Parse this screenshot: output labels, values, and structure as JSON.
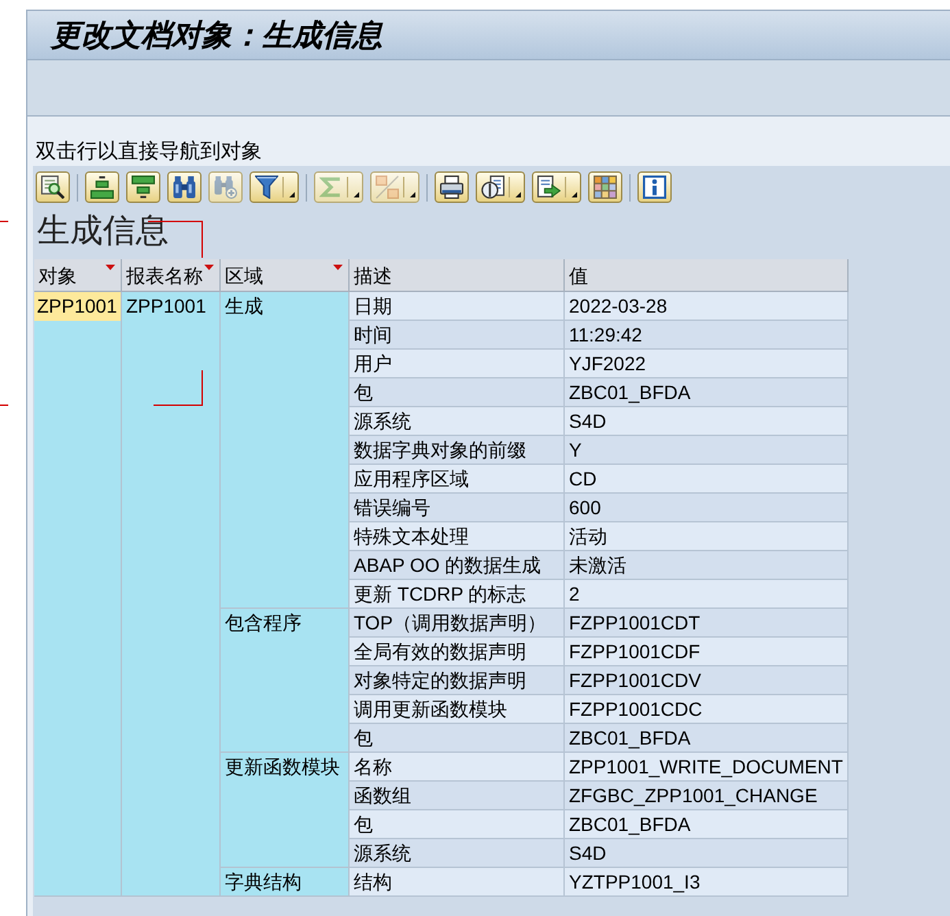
{
  "window": {
    "title": "更改文档对象：生成信息"
  },
  "hint": "双击行以直接导航到对象",
  "toolbar": [
    [
      {
        "kind": "details",
        "disabled": false,
        "menu": false
      }
    ],
    [
      {
        "kind": "sort_ascending",
        "disabled": false,
        "menu": false
      },
      {
        "kind": "sort_descending",
        "disabled": false,
        "menu": false
      },
      {
        "kind": "find",
        "disabled": false,
        "menu": false
      },
      {
        "kind": "find_next",
        "disabled": true,
        "menu": false
      },
      {
        "kind": "filter",
        "disabled": false,
        "menu": true
      }
    ],
    [
      {
        "kind": "sum",
        "disabled": true,
        "menu": true
      },
      {
        "kind": "subtotals",
        "disabled": true,
        "menu": true
      }
    ],
    [
      {
        "kind": "print",
        "disabled": false,
        "menu": false
      },
      {
        "kind": "view",
        "disabled": false,
        "menu": true
      },
      {
        "kind": "export",
        "disabled": false,
        "menu": true
      },
      {
        "kind": "layout",
        "disabled": false,
        "menu": false
      }
    ],
    [
      {
        "kind": "info",
        "disabled": false,
        "menu": false
      }
    ]
  ],
  "report": {
    "title": "生成信息",
    "columns": [
      {
        "label": "对象",
        "sorted": true
      },
      {
        "label": "报表名称",
        "sorted": true
      },
      {
        "label": "区域",
        "sorted": true
      },
      {
        "label": "描述",
        "sorted": false
      },
      {
        "label": "值",
        "sorted": false
      }
    ],
    "object": {
      "text": "ZPP1001",
      "selected": true
    },
    "report_name": "ZPP1001",
    "areas": [
      {
        "label": "生成",
        "rows": [
          {
            "description": "日期",
            "value": "2022-03-28"
          },
          {
            "description": "时间",
            "value": "11:29:42"
          },
          {
            "description": "用户",
            "value": "YJF2022"
          },
          {
            "description": "包",
            "value": "ZBC01_BFDA"
          },
          {
            "description": "源系统",
            "value": "S4D"
          },
          {
            "description": "数据字典对象的前缀",
            "value": "Y"
          },
          {
            "description": "应用程序区域",
            "value": "CD"
          },
          {
            "description": "错误编号",
            "value": "600"
          },
          {
            "description": "特殊文本处理",
            "value": "活动"
          },
          {
            "description": "ABAP OO 的数据生成",
            "value": "未激活"
          },
          {
            "description": "更新 TCDRP 的标志",
            "value": "2"
          }
        ]
      },
      {
        "label": "包含程序",
        "rows": [
          {
            "description": "TOP（调用数据声明）",
            "value": "FZPP1001CDT"
          },
          {
            "description": "全局有效的数据声明",
            "value": "FZPP1001CDF"
          },
          {
            "description": "对象特定的数据声明",
            "value": "FZPP1001CDV"
          },
          {
            "description": "调用更新函数模块",
            "value": "FZPP1001CDC"
          },
          {
            "description": "包",
            "value": "ZBC01_BFDA"
          }
        ]
      },
      {
        "label": "更新函数模块",
        "rows": [
          {
            "description": "名称",
            "value": "ZPP1001_WRITE_DOCUMENT"
          },
          {
            "description": "函数组",
            "value": "ZFGBC_ZPP1001_CHANGE"
          },
          {
            "description": "包",
            "value": "ZBC01_BFDA"
          },
          {
            "description": "源系统",
            "value": "S4D"
          }
        ]
      },
      {
        "label": "字典结构",
        "rows": [
          {
            "description": "结构",
            "value": "YZTPP1001_I3"
          }
        ]
      }
    ]
  }
}
